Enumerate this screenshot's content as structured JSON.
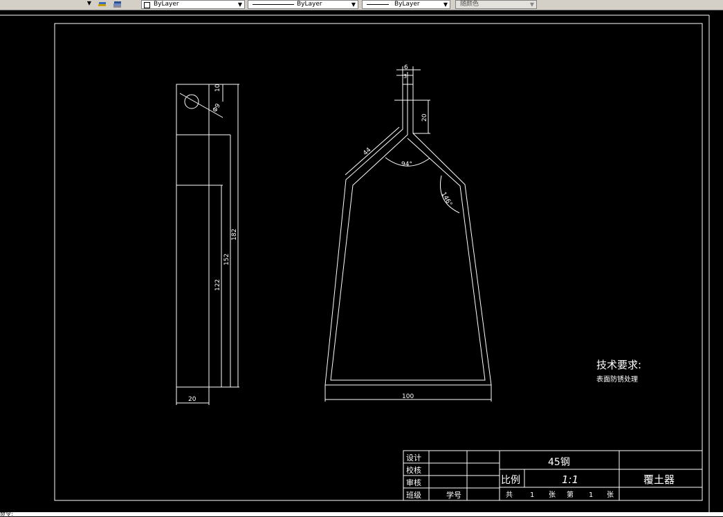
{
  "toolbar": {
    "color_value": "ByLayer",
    "linetype_value": "ByLayer",
    "lineweight_value": "ByLayer",
    "plotstyle_value": "随颜色"
  },
  "drawing": {
    "left_view": {
      "dim_hole_offset": "10",
      "dim_hole_diameter": "Φ9",
      "dim_total_height": "182",
      "dim_mid_height": "152",
      "dim_lower_height": "122",
      "dim_width": "20"
    },
    "front_view": {
      "dim_top_width": "6",
      "dim_slot_width": "3",
      "dim_neck_height": "20",
      "dim_arm_length": "44",
      "dim_angle_top": "94°",
      "dim_angle_side": "146°",
      "dim_base_width": "100"
    },
    "tech_req_title": "技术要求:",
    "tech_req_text": "表面防锈处理"
  },
  "title_block": {
    "row_design": "设计",
    "row_check": "校核",
    "row_review": "审核",
    "row_class": "班级",
    "student_no": "学号",
    "material": "45钢",
    "scale_label": "比例",
    "scale_value": "1:1",
    "part_name": "覆土器",
    "total_label": "共",
    "total_value": "1",
    "sheet_unit1": "张",
    "sheet_label": "第",
    "sheet_value": "1",
    "sheet_unit2": "张"
  },
  "command_line": "命令:"
}
